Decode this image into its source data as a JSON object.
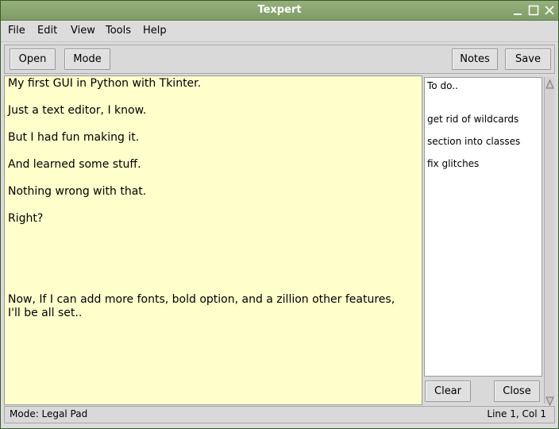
{
  "window": {
    "title": "Texpert"
  },
  "menu": [
    "File",
    "Edit",
    "View",
    "Tools",
    "Help"
  ],
  "toolbar": {
    "open_label": "Open",
    "mode_label": "Mode",
    "notes_label": "Notes",
    "save_label": "Save"
  },
  "editor": {
    "lines": [
      "My first GUI in Python with Tkinter.",
      "Just a text editor, I know.",
      "But I had fun making it.",
      "And learned some stuff.",
      "Nothing wrong with that.",
      "Right?",
      "Now, If I can add more fonts, bold option, and a zillion other features,",
      "I'll be all set.."
    ]
  },
  "notes": {
    "lines": [
      "To do..",
      "get rid of wildcards",
      "section into classes",
      "fix glitches"
    ],
    "clear_label": "Clear",
    "close_label": "Close"
  },
  "status": {
    "mode": "Mode: Legal Pad",
    "position": "Line 1, Col 1"
  },
  "colors": {
    "titlebar": "#7f9c66",
    "editor_bg": "#ffffcc",
    "chrome": "#dcdcdc"
  },
  "icons": [
    "minimize-icon",
    "maximize-icon",
    "close-icon",
    "scroll-up-arrow-icon",
    "scroll-down-arrow-icon"
  ]
}
